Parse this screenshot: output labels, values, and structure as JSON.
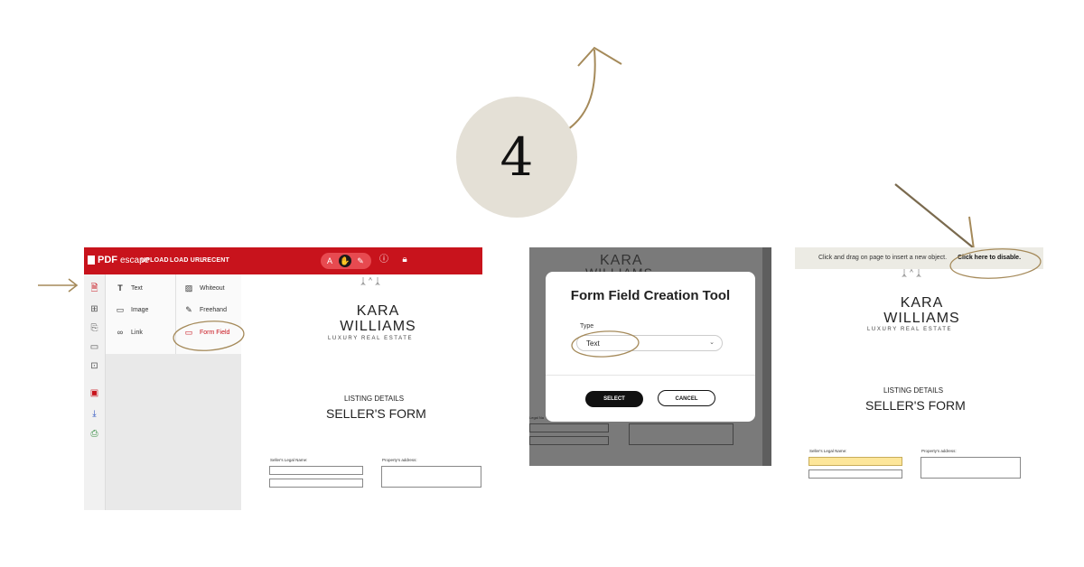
{
  "step": {
    "number": "4"
  },
  "colors": {
    "accent_brown": "#a58a5a",
    "brand_red": "#c8131c",
    "circle_bg": "#e4e0d6",
    "field_yellow": "#fde69a"
  },
  "panel1": {
    "logo_bold": "PDF",
    "logo_light": "escape",
    "nav": [
      "UPLOAD",
      "LOAD URL",
      "RECENT"
    ],
    "mode_label": "A",
    "tools": {
      "text": "Text",
      "whiteout": "Whiteout",
      "image": "Image",
      "freehand": "Freehand",
      "link": "Link",
      "form_field": "Form Field"
    }
  },
  "document": {
    "logo_mark": "ᛣ⌃ᛣ",
    "name_line1": "KARA",
    "name_line2": "WILLIAMS",
    "tagline": "LUXURY REAL ESTATE",
    "listing": "LISTING DETAILS",
    "form_title": "SELLER'S FORM",
    "seller_label": "Seller's Legal Name:",
    "property_label": "Property's address:"
  },
  "panel2": {
    "dialog_title": "Form Field Creation Tool",
    "type_label": "Type",
    "type_value": "Text",
    "select_button": "SELECT",
    "cancel_button": "CANCEL",
    "bg_label": "Legal Na"
  },
  "panel3": {
    "hint_text": "Click and drag on page to insert a new object.",
    "hint_link": "Click here to disable."
  }
}
